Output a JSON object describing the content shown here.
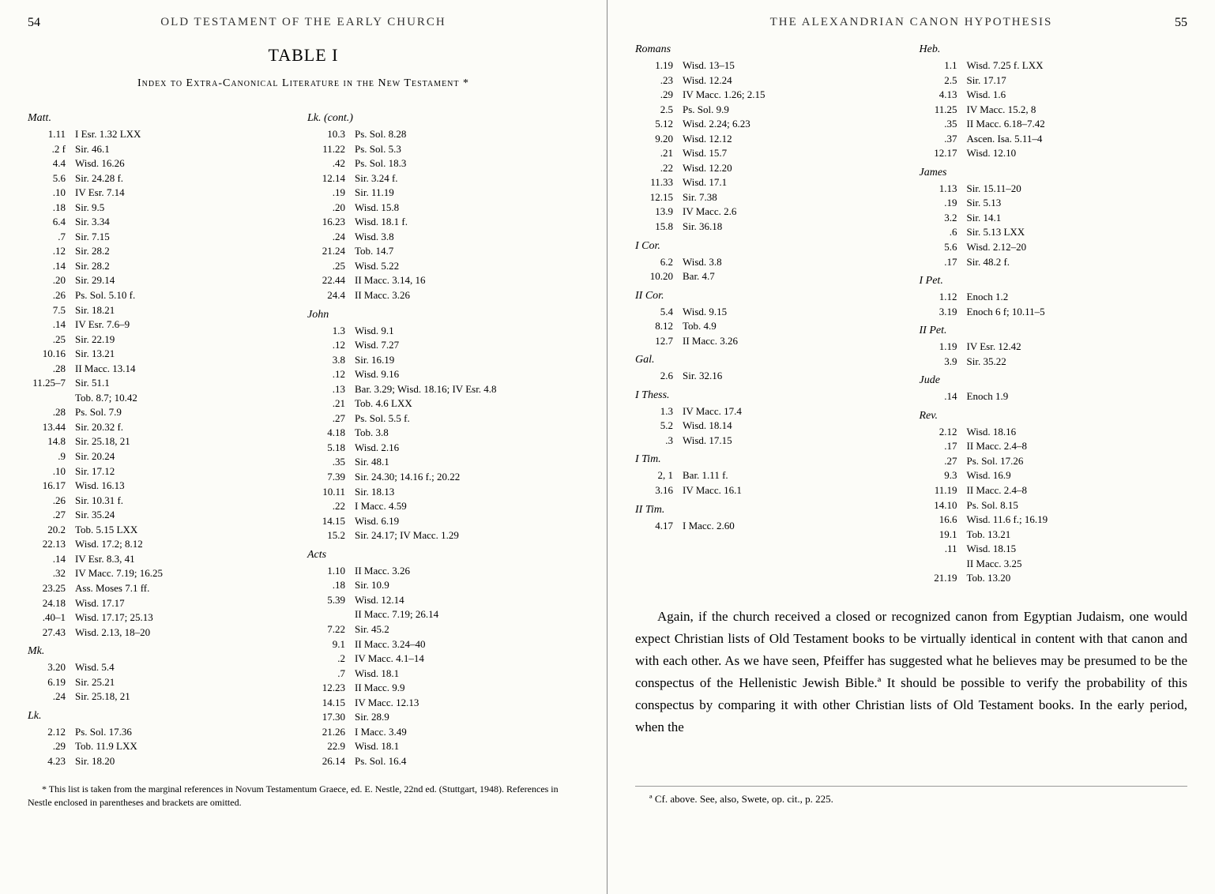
{
  "left_page": {
    "page_number": "54",
    "running_head": "OLD TESTAMENT OF THE EARLY CHURCH",
    "table_title": "TABLE I",
    "table_subtitle": "Index to Extra-Canonical Literature in the New Testament *",
    "columns": [
      {
        "groups": [
          {
            "book": "Matt.",
            "entries": [
              {
                "v": "1.11",
                "r": "I Esr. 1.32 LXX"
              },
              {
                "v": ".2 f",
                "r": "Sir. 46.1"
              },
              {
                "v": "4.4",
                "r": "Wisd. 16.26"
              },
              {
                "v": "5.6",
                "r": "Sir. 24.28 f."
              },
              {
                "v": ".10",
                "r": "IV Esr. 7.14"
              },
              {
                "v": ".18",
                "r": "Sir. 9.5"
              },
              {
                "v": "6.4",
                "r": "Sir. 3.34"
              },
              {
                "v": ".7",
                "r": "Sir. 7.15"
              },
              {
                "v": ".12",
                "r": "Sir. 28.2"
              },
              {
                "v": ".14",
                "r": "Sir. 28.2"
              },
              {
                "v": ".20",
                "r": "Sir. 29.14"
              },
              {
                "v": ".26",
                "r": "Ps. Sol. 5.10 f."
              },
              {
                "v": "7.5",
                "r": "Sir. 18.21"
              },
              {
                "v": ".14",
                "r": "IV Esr. 7.6–9"
              },
              {
                "v": ".25",
                "r": "Sir. 22.19"
              },
              {
                "v": "10.16",
                "r": "Sir. 13.21"
              },
              {
                "v": ".28",
                "r": "II Macc. 13.14"
              },
              {
                "v": "11.25–7",
                "r": "Sir. 51.1"
              },
              {
                "v": "",
                "r": "Tob. 8.7; 10.42"
              },
              {
                "v": ".28",
                "r": "Ps. Sol. 7.9"
              },
              {
                "v": "13.44",
                "r": "Sir. 20.32 f."
              },
              {
                "v": "14.8",
                "r": "Sir. 25.18, 21"
              },
              {
                "v": ".9",
                "r": "Sir. 20.24"
              },
              {
                "v": ".10",
                "r": "Sir. 17.12"
              },
              {
                "v": "16.17",
                "r": "Wisd. 16.13"
              },
              {
                "v": ".26",
                "r": "Sir. 10.31 f."
              },
              {
                "v": ".27",
                "r": "Sir. 35.24"
              },
              {
                "v": "20.2",
                "r": "Tob. 5.15 LXX"
              },
              {
                "v": "22.13",
                "r": "Wisd. 17.2; 8.12"
              },
              {
                "v": ".14",
                "r": "IV Esr. 8.3, 41"
              },
              {
                "v": ".32",
                "r": "IV Macc. 7.19; 16.25"
              },
              {
                "v": "23.25",
                "r": "Ass. Moses 7.1 ff."
              },
              {
                "v": "24.18",
                "r": "Wisd. 17.17"
              },
              {
                "v": ".40–1",
                "r": "Wisd. 17.17; 25.13"
              },
              {
                "v": "27.43",
                "r": "Wisd. 2.13, 18–20"
              }
            ]
          },
          {
            "book": "Mk.",
            "entries": [
              {
                "v": "3.20",
                "r": "Wisd. 5.4"
              },
              {
                "v": "6.19",
                "r": "Sir. 25.21"
              },
              {
                "v": ".24",
                "r": "Sir. 25.18, 21"
              }
            ]
          },
          {
            "book": "Lk.",
            "entries": [
              {
                "v": "2.12",
                "r": "Ps. Sol. 17.36"
              },
              {
                "v": ".29",
                "r": "Tob. 11.9 LXX"
              },
              {
                "v": "4.23",
                "r": "Sir. 18.20"
              }
            ]
          }
        ]
      },
      {
        "groups": [
          {
            "book": "Lk. (cont.)",
            "entries": [
              {
                "v": "10.3",
                "r": "Ps. Sol. 8.28"
              },
              {
                "v": "11.22",
                "r": "Ps. Sol. 5.3"
              },
              {
                "v": ".42",
                "r": "Ps. Sol. 18.3"
              },
              {
                "v": "12.14",
                "r": "Sir. 3.24 f."
              },
              {
                "v": ".19",
                "r": "Sir. 11.19"
              },
              {
                "v": ".20",
                "r": "Wisd. 15.8"
              },
              {
                "v": "16.23",
                "r": "Wisd. 18.1 f."
              },
              {
                "v": ".24",
                "r": "Wisd. 3.8"
              },
              {
                "v": "21.24",
                "r": "Tob. 14.7"
              },
              {
                "v": ".25",
                "r": "Wisd. 5.22"
              },
              {
                "v": "22.44",
                "r": "II Macc. 3.14, 16"
              },
              {
                "v": "24.4",
                "r": "II Macc. 3.26"
              }
            ]
          },
          {
            "book": "John",
            "entries": [
              {
                "v": "1.3",
                "r": "Wisd. 9.1"
              },
              {
                "v": ".12",
                "r": "Wisd. 7.27"
              },
              {
                "v": "3.8",
                "r": "Sir. 16.19"
              },
              {
                "v": ".12",
                "r": "Wisd. 9.16"
              },
              {
                "v": ".13",
                "r": "Bar. 3.29; Wisd. 18.16; IV Esr. 4.8"
              },
              {
                "v": ".21",
                "r": "Tob. 4.6 LXX"
              },
              {
                "v": ".27",
                "r": "Ps. Sol. 5.5 f."
              },
              {
                "v": "4.18",
                "r": "Tob. 3.8"
              },
              {
                "v": "5.18",
                "r": "Wisd. 2.16"
              },
              {
                "v": ".35",
                "r": "Sir. 48.1"
              },
              {
                "v": "7.39",
                "r": "Sir. 24.30; 14.16 f.; 20.22"
              },
              {
                "v": "10.11",
                "r": "Sir. 18.13"
              },
              {
                "v": ".22",
                "r": "I Macc. 4.59"
              },
              {
                "v": "14.15",
                "r": "Wisd. 6.19"
              },
              {
                "v": "15.2",
                "r": "Sir. 24.17; IV Macc. 1.29"
              }
            ]
          },
          {
            "book": "Acts",
            "entries": [
              {
                "v": "1.10",
                "r": "II Macc. 3.26"
              },
              {
                "v": ".18",
                "r": "Sir. 10.9"
              },
              {
                "v": "5.39",
                "r": "Wisd. 12.14"
              },
              {
                "v": "",
                "r": "II Macc. 7.19; 26.14"
              },
              {
                "v": "7.22",
                "r": "Sir. 45.2"
              },
              {
                "v": "9.1",
                "r": "II Macc. 3.24–40"
              },
              {
                "v": ".2",
                "r": "IV Macc. 4.1–14"
              },
              {
                "v": ".7",
                "r": "Wisd. 18.1"
              },
              {
                "v": "12.23",
                "r": "II Macc. 9.9"
              },
              {
                "v": "14.15",
                "r": "IV Macc. 12.13"
              },
              {
                "v": "17.30",
                "r": "Sir. 28.9"
              },
              {
                "v": "21.26",
                "r": "I Macc. 3.49"
              },
              {
                "v": "22.9",
                "r": "Wisd. 18.1"
              },
              {
                "v": "26.14",
                "r": "Ps. Sol. 16.4"
              }
            ]
          }
        ]
      }
    ],
    "footnote": "* This list is taken from the marginal references in Novum Testamentum Graece, ed. E. Nestle, 22nd ed. (Stuttgart, 1948). References in Nestle enclosed in parentheses and brackets are omitted."
  },
  "right_page": {
    "page_number": "55",
    "running_head": "THE ALEXANDRIAN CANON HYPOTHESIS",
    "columns": [
      {
        "groups": [
          {
            "book": "Romans",
            "entries": [
              {
                "v": "1.19",
                "r": "Wisd. 13–15"
              },
              {
                "v": ".23",
                "r": "Wisd. 12.24"
              },
              {
                "v": ".29",
                "r": "IV Macc. 1.26; 2.15"
              },
              {
                "v": "2.5",
                "r": "Ps. Sol. 9.9"
              },
              {
                "v": "5.12",
                "r": "Wisd. 2.24; 6.23"
              },
              {
                "v": "9.20",
                "r": "Wisd. 12.12"
              },
              {
                "v": ".21",
                "r": "Wisd. 15.7"
              },
              {
                "v": ".22",
                "r": "Wisd. 12.20"
              },
              {
                "v": "11.33",
                "r": "Wisd. 17.1"
              },
              {
                "v": "12.15",
                "r": "Sir. 7.38"
              },
              {
                "v": "13.9",
                "r": "IV Macc. 2.6"
              },
              {
                "v": "15.8",
                "r": "Sir. 36.18"
              }
            ]
          },
          {
            "book": "I Cor.",
            "entries": [
              {
                "v": "6.2",
                "r": "Wisd. 3.8"
              },
              {
                "v": "10.20",
                "r": "Bar. 4.7"
              }
            ]
          },
          {
            "book": "II Cor.",
            "entries": [
              {
                "v": "5.4",
                "r": "Wisd. 9.15"
              },
              {
                "v": "8.12",
                "r": "Tob. 4.9"
              },
              {
                "v": "12.7",
                "r": "II Macc. 3.26"
              }
            ]
          },
          {
            "book": "Gal.",
            "entries": [
              {
                "v": "2.6",
                "r": "Sir. 32.16"
              }
            ]
          },
          {
            "book": "I Thess.",
            "entries": [
              {
                "v": "1.3",
                "r": "IV Macc. 17.4"
              },
              {
                "v": "5.2",
                "r": "Wisd. 18.14"
              },
              {
                "v": ".3",
                "r": "Wisd. 17.15"
              }
            ]
          },
          {
            "book": "I Tim.",
            "entries": [
              {
                "v": "2, 1",
                "r": "Bar. 1.11 f."
              },
              {
                "v": "3.16",
                "r": "IV Macc. 16.1"
              }
            ]
          },
          {
            "book": "II Tim.",
            "entries": [
              {
                "v": "4.17",
                "r": "I Macc. 2.60"
              }
            ]
          }
        ]
      },
      {
        "groups": [
          {
            "book": "Heb.",
            "entries": [
              {
                "v": "1.1",
                "r": "Wisd. 7.25 f. LXX"
              },
              {
                "v": "2.5",
                "r": "Sir. 17.17"
              },
              {
                "v": "4.13",
                "r": "Wisd. 1.6"
              },
              {
                "v": "11.25",
                "r": "IV Macc. 15.2, 8"
              },
              {
                "v": ".35",
                "r": "II Macc. 6.18–7.42"
              },
              {
                "v": ".37",
                "r": "Ascen. Isa. 5.11–4"
              },
              {
                "v": "12.17",
                "r": "Wisd. 12.10"
              }
            ]
          },
          {
            "book": "James",
            "entries": [
              {
                "v": "1.13",
                "r": "Sir. 15.11–20"
              },
              {
                "v": ".19",
                "r": "Sir. 5.13"
              },
              {
                "v": "3.2",
                "r": "Sir. 14.1"
              },
              {
                "v": ".6",
                "r": "Sir. 5.13 LXX"
              },
              {
                "v": "5.6",
                "r": "Wisd. 2.12–20"
              },
              {
                "v": ".17",
                "r": "Sir. 48.2 f."
              }
            ]
          },
          {
            "book": "I Pet.",
            "entries": [
              {
                "v": "1.12",
                "r": "Enoch 1.2"
              },
              {
                "v": "3.19",
                "r": "Enoch 6 f; 10.11–5"
              }
            ]
          },
          {
            "book": "II Pet.",
            "entries": [
              {
                "v": "1.19",
                "r": "IV Esr. 12.42"
              },
              {
                "v": "3.9",
                "r": "Sir. 35.22"
              }
            ]
          },
          {
            "book": "Jude",
            "entries": [
              {
                "v": ".14",
                "r": "Enoch 1.9"
              }
            ]
          },
          {
            "book": "Rev.",
            "entries": [
              {
                "v": "2.12",
                "r": "Wisd. 18.16"
              },
              {
                "v": ".17",
                "r": "II Macc. 2.4–8"
              },
              {
                "v": ".27",
                "r": "Ps. Sol. 17.26"
              },
              {
                "v": "9.3",
                "r": "Wisd. 16.9"
              },
              {
                "v": "11.19",
                "r": "II Macc. 2.4–8"
              },
              {
                "v": "14.10",
                "r": "Ps. Sol. 8.15"
              },
              {
                "v": "16.6",
                "r": "Wisd. 11.6 f.; 16.19"
              },
              {
                "v": "19.1",
                "r": "Tob. 13.21"
              },
              {
                "v": ".11",
                "r": "Wisd. 18.15"
              },
              {
                "v": "",
                "r": "II Macc. 3.25"
              },
              {
                "v": "21.19",
                "r": "Tob. 13.20"
              }
            ]
          }
        ]
      }
    ],
    "body_text": "Again, if the church received a closed or recognized canon from Egyptian Judaism, one would expect Christian lists of Old Testament books to be virtually identical in content with that canon and with each other. As we have seen, Pfeiffer has suggested what he believes may be presumed to be the conspectus of the Hellenistic Jewish Bible.ª It should be possible to verify the probability of this conspectus by comparing it with other Christian lists of Old Testament books. In the early period, when the",
    "footnote_bottom": "ª Cf. above. See, also, Swete, op. cit., p. 225."
  }
}
